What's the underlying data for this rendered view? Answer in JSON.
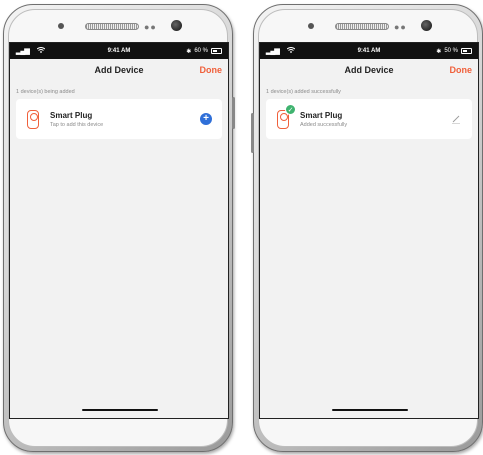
{
  "left_screen": {
    "status": {
      "time": "9:41 AM",
      "battery": "60 %"
    },
    "nav": {
      "title": "Add Device",
      "done": "Done"
    },
    "section": "1 device(s) being added",
    "device": {
      "name": "Smart Plug",
      "subtitle": "Tap to add this device"
    },
    "action_icon": "plus-circle-icon"
  },
  "right_screen": {
    "status": {
      "time": "9:41 AM",
      "battery": "50 %"
    },
    "nav": {
      "title": "Add Device",
      "done": "Done"
    },
    "section": "1 device(s) added successfully",
    "device": {
      "name": "Smart Plug",
      "subtitle": "Added successfully"
    },
    "action_icon": "edit-pencil-icon"
  },
  "colors": {
    "accent": "#f0603b",
    "add_blue": "#2f6fd8",
    "success_green": "#3fb36f"
  }
}
